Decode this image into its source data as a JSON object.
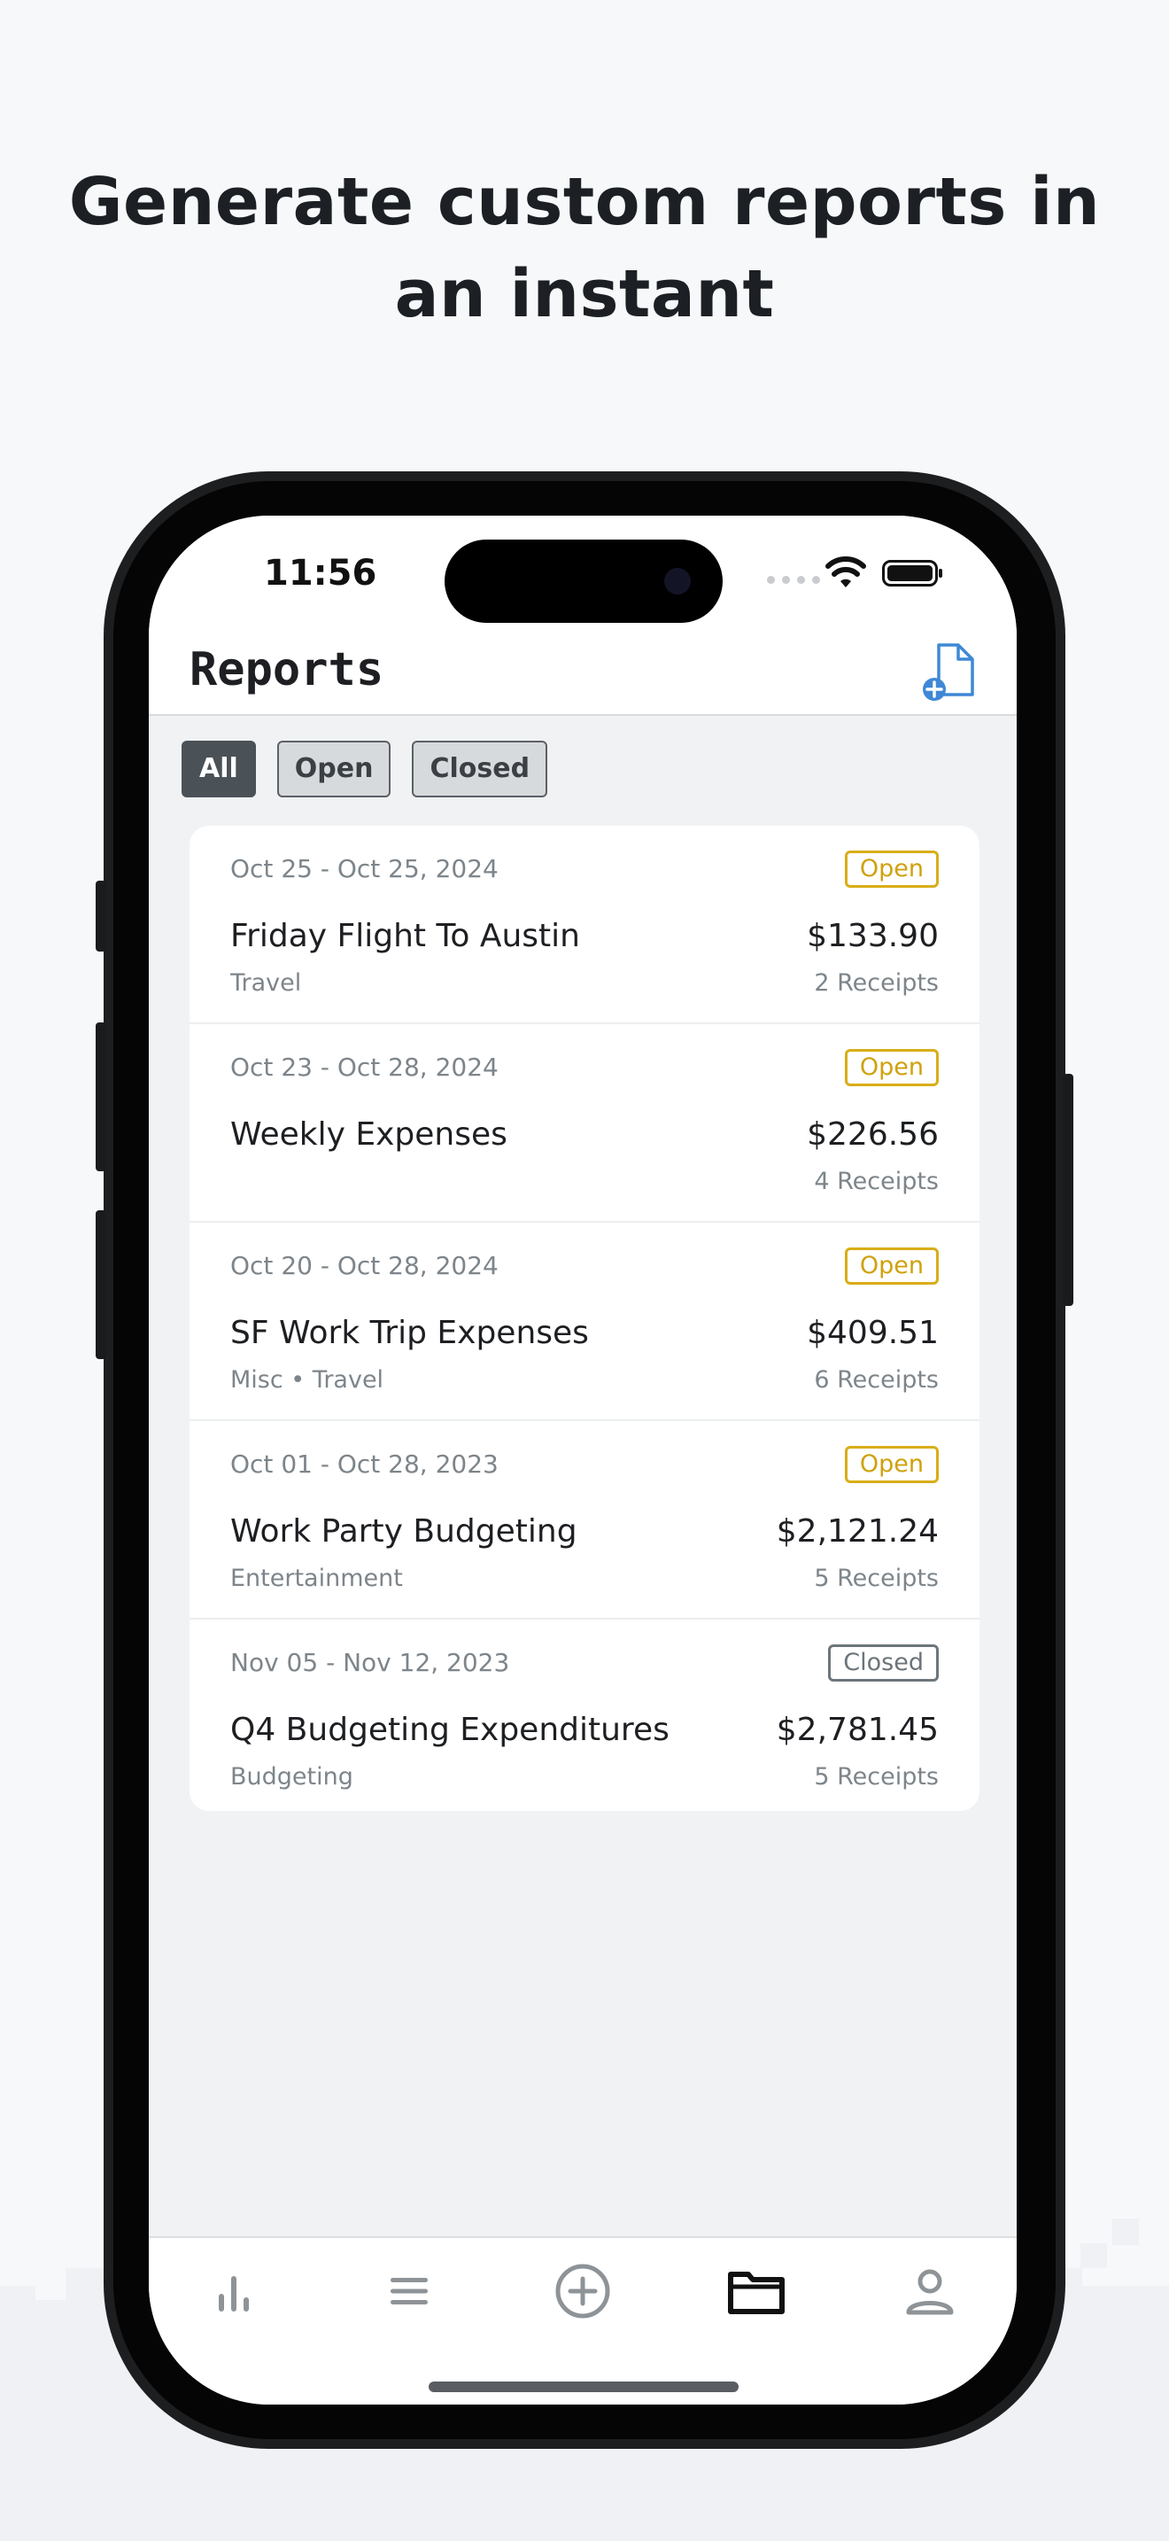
{
  "headline": {
    "line1": "Generate custom reports in",
    "line2": "an instant"
  },
  "status_bar": {
    "time": "11:56"
  },
  "nav": {
    "title": "Reports",
    "new_report_icon": "new-report-document-plus-icon"
  },
  "filters": [
    {
      "label": "All",
      "active": true
    },
    {
      "label": "Open",
      "active": false
    },
    {
      "label": "Closed",
      "active": false
    }
  ],
  "reports": [
    {
      "date_range": "Oct 25 - Oct 25, 2024",
      "status": "Open",
      "name": "Friday Flight To Austin",
      "amount": "$133.90",
      "category": "Travel",
      "receipts": "2 Receipts"
    },
    {
      "date_range": "Oct 23 - Oct 28, 2024",
      "status": "Open",
      "name": "Weekly Expenses",
      "amount": "$226.56",
      "category": "",
      "receipts": "4 Receipts"
    },
    {
      "date_range": "Oct 20 - Oct 28, 2024",
      "status": "Open",
      "name": "SF Work Trip Expenses",
      "amount": "$409.51",
      "category": "Misc • Travel",
      "receipts": "6 Receipts"
    },
    {
      "date_range": "Oct 01 - Oct 28, 2023",
      "status": "Open",
      "name": "Work Party Budgeting",
      "amount": "$2,121.24",
      "category": "Entertainment",
      "receipts": "5 Receipts"
    },
    {
      "date_range": "Nov 05 - Nov 12, 2023",
      "status": "Closed",
      "name": "Q4 Budgeting Expenditures",
      "amount": "$2,781.45",
      "category": "Budgeting",
      "receipts": "5 Receipts"
    }
  ],
  "tab_bar": {
    "tabs": [
      {
        "icon": "bar-chart-icon",
        "active": false
      },
      {
        "icon": "list-icon",
        "active": false
      },
      {
        "icon": "plus-circle-icon",
        "active": false
      },
      {
        "icon": "folder-icon",
        "active": true
      },
      {
        "icon": "person-icon",
        "active": false
      }
    ]
  },
  "colors": {
    "open_badge": "#d9ad17",
    "closed_badge": "#6d767c",
    "accent_blue": "#3f88d6",
    "active_chip": "#4a5157"
  }
}
